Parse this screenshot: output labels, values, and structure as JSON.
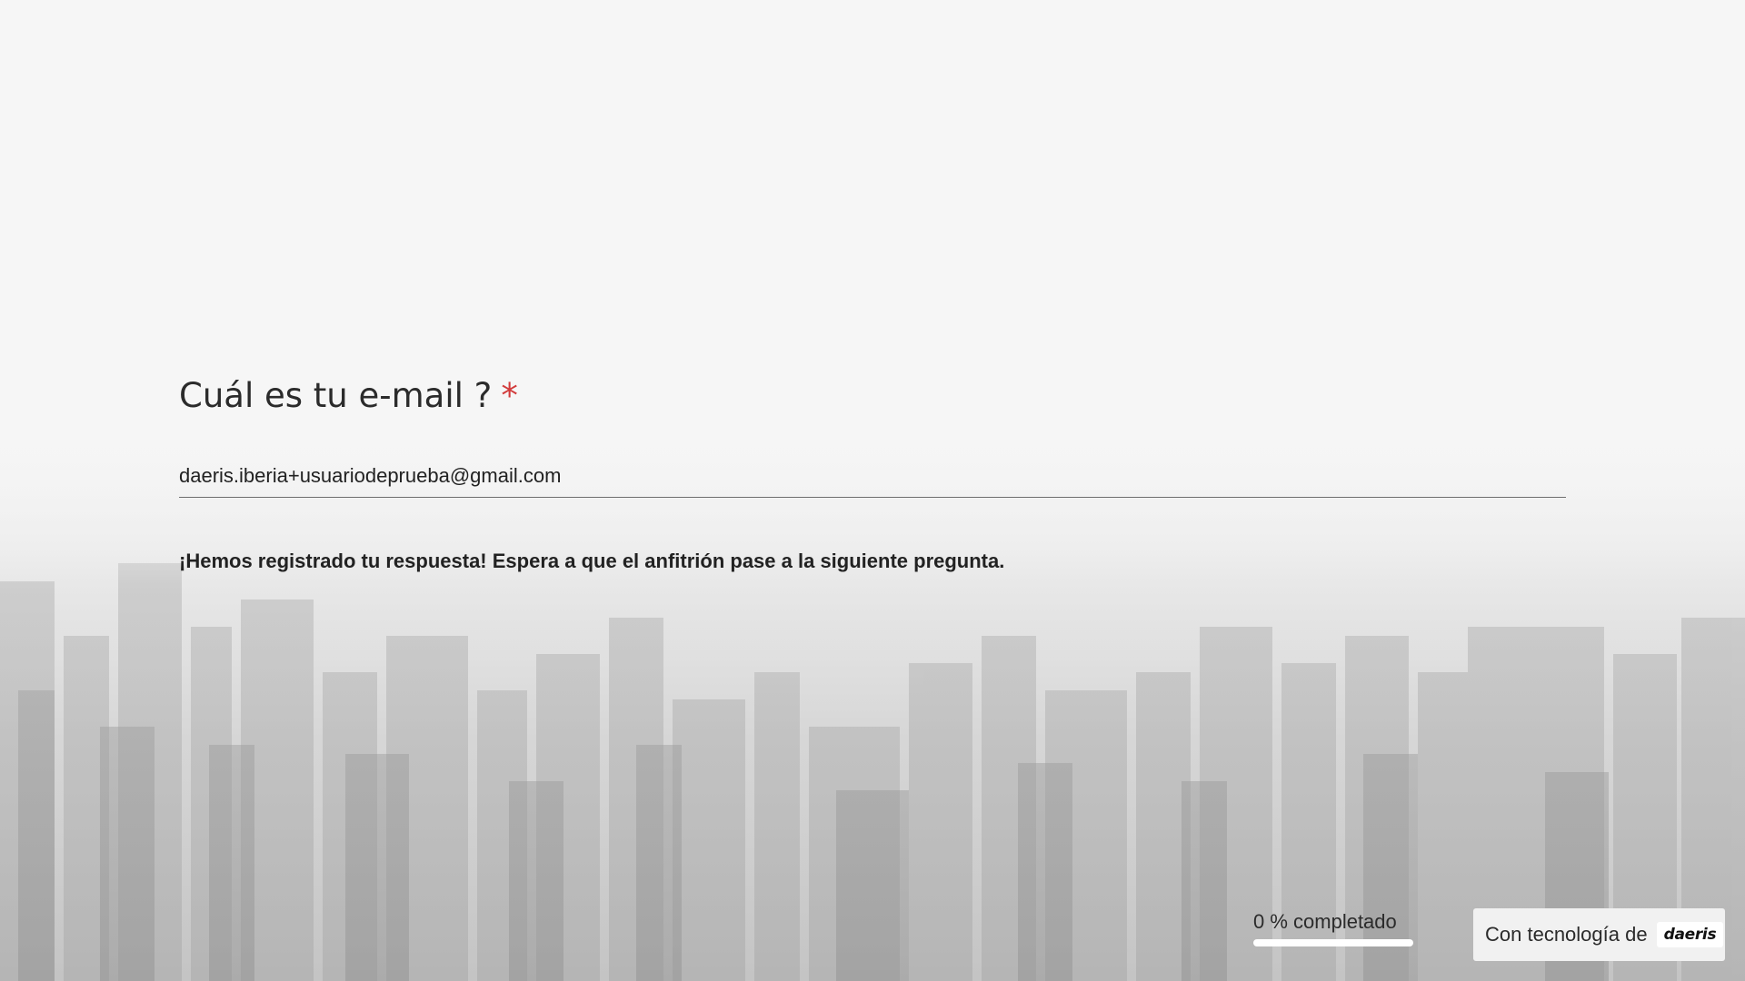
{
  "question": {
    "title": "Cuál es tu e-mail ?",
    "required_marker": "*"
  },
  "email_field": {
    "value": "daeris.iberia+usuariodeprueba@gmail.com"
  },
  "confirmation_message": "¡Hemos registrado tu respuesta! Espera a que el anfitrión pase a la siguiente pregunta.",
  "progress": {
    "label": "0 % completado",
    "percent": 0
  },
  "footer": {
    "powered_by_label": "Con tecnología de",
    "brand": "daeris"
  },
  "colors": {
    "required_marker": "#d23b3b",
    "text": "#2b2b2b",
    "progress_track": "#ffffff"
  }
}
